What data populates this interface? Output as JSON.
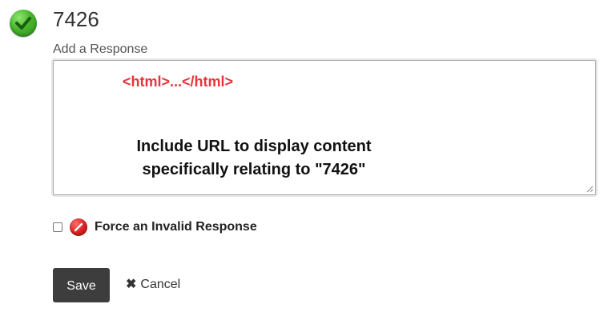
{
  "header": {
    "status_icon": "checkmark-success-icon",
    "status_color": "#46b52b",
    "title": "7426"
  },
  "response": {
    "label": "Add a Response",
    "value_html_tag": "<html>...</html>",
    "value_line1": "Include URL to display content",
    "value_line2": "specifically relating to \"7426\"",
    "tag_color": "#e8343a"
  },
  "invalid_option": {
    "checked": false,
    "icon": "no-entry-icon",
    "icon_color": "#d61f1f",
    "label": "Force an Invalid Response"
  },
  "actions": {
    "save_label": "Save",
    "cancel_icon": "close-icon",
    "cancel_label": "Cancel",
    "save_bg": "#3d3d3d"
  }
}
